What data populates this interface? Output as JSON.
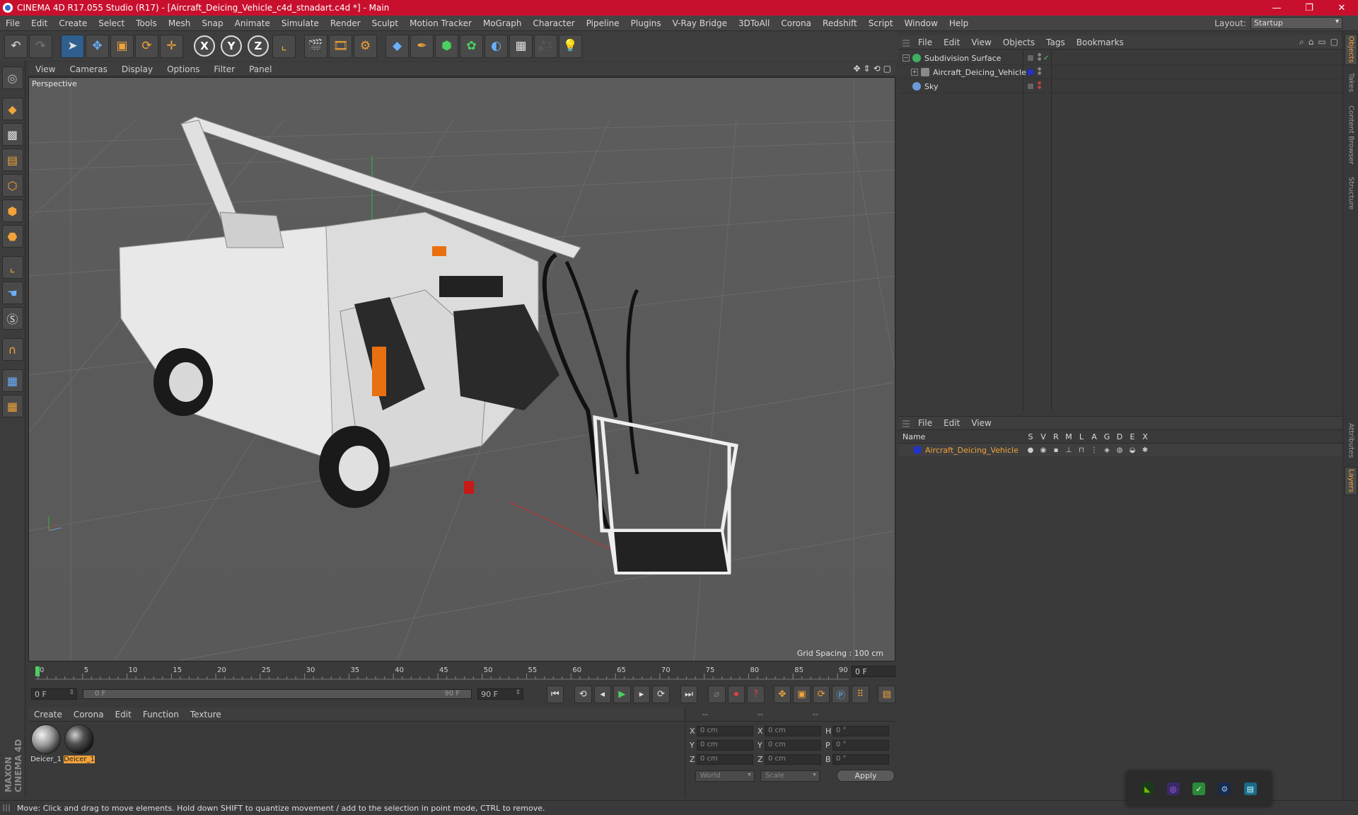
{
  "window": {
    "title": "CINEMA 4D R17.055 Studio (R17) - [Aircraft_Deicing_Vehicle_c4d_stnadart.c4d *] - Main",
    "minimize": "—",
    "maximize": "❐",
    "close": "✕"
  },
  "menubar": {
    "items": [
      "File",
      "Edit",
      "Create",
      "Select",
      "Tools",
      "Mesh",
      "Snap",
      "Animate",
      "Simulate",
      "Render",
      "Sculpt",
      "Motion Tracker",
      "MoGraph",
      "Character",
      "Pipeline",
      "Plugins",
      "V-Ray Bridge",
      "3DToAll",
      "Corona",
      "Redshift",
      "Script",
      "Window",
      "Help"
    ],
    "layout_label": "Layout:",
    "layout_value": "Startup"
  },
  "viewport": {
    "menu": [
      "View",
      "Cameras",
      "Display",
      "Options",
      "Filter",
      "Panel"
    ],
    "label": "Perspective",
    "grid_spacing": "Grid Spacing : 100 cm"
  },
  "timeline": {
    "ticks": [
      "0",
      "5",
      "10",
      "15",
      "20",
      "25",
      "30",
      "35",
      "40",
      "45",
      "50",
      "55",
      "60",
      "65",
      "70",
      "75",
      "80",
      "85",
      "90"
    ],
    "current_frame": "0 F",
    "start_field": "0 F",
    "range_start": "0 F",
    "range_end": "90 F",
    "end_field": "90 F"
  },
  "material_manager": {
    "menu": [
      "Create",
      "Corona",
      "Edit",
      "Function",
      "Texture"
    ],
    "materials": [
      {
        "name": "Deicer_1",
        "selected": false
      },
      {
        "name": "Deicer_1",
        "selected": true
      }
    ]
  },
  "coordinates": {
    "headers": [
      "--",
      "--",
      "--"
    ],
    "rows": [
      {
        "a1": "X",
        "v1": "0 cm",
        "a2": "X",
        "v2": "0 cm",
        "a3": "H",
        "v3": "0 °"
      },
      {
        "a1": "Y",
        "v1": "0 cm",
        "a2": "Y",
        "v2": "0 cm",
        "a3": "P",
        "v3": "0 °"
      },
      {
        "a1": "Z",
        "v1": "0 cm",
        "a2": "Z",
        "v2": "0 cm",
        "a3": "B",
        "v3": "0 °"
      }
    ],
    "space_select": "World",
    "mode_select": "Scale",
    "apply_label": "Apply"
  },
  "object_manager": {
    "menu": [
      "File",
      "Edit",
      "View",
      "Objects",
      "Tags",
      "Bookmarks"
    ],
    "objects": [
      {
        "name": "Subdivision Surface",
        "icon_color": "#3fb060"
      },
      {
        "name": "Aircraft_Deicing_Vehicle",
        "icon_color": "#8a8a8a"
      },
      {
        "name": "Sky",
        "icon_color": "#6a9ad8"
      }
    ]
  },
  "layer_manager": {
    "menu": [
      "File",
      "Edit",
      "View"
    ],
    "columns": [
      "Name",
      "S",
      "V",
      "R",
      "M",
      "L",
      "A",
      "G",
      "D",
      "E",
      "X"
    ],
    "layer_name": "Aircraft_Deicing_Vehicle",
    "layer_color": "#2233cc"
  },
  "side_tabs": [
    "Objects",
    "Takes",
    "Content Browser",
    "Structure",
    "Attributes",
    "Layers"
  ],
  "status": {
    "text": "Move: Click and drag to move elements. Hold down SHIFT to quantize movement / add to the selection in point mode, CTRL to remove."
  },
  "branding": "MAXON CINEMA 4D",
  "colors": {
    "title_bar": "#c8102e",
    "accent_orange": "#f2a33a",
    "panel": "#3a3a3a"
  }
}
